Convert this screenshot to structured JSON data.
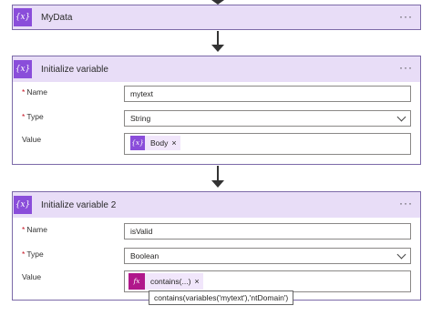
{
  "mydata_card": {
    "title": "MyData",
    "more_label": "···",
    "icon": "variable-icon"
  },
  "init_var_1": {
    "title": "Initialize variable",
    "more_label": "···",
    "name_label": "Name",
    "name_value": "mytext",
    "type_label": "Type",
    "type_value": "String",
    "value_label": "Value",
    "value_token": "Body",
    "token_remove": "×",
    "required_marker": "*"
  },
  "init_var_2": {
    "title": "Initialize variable 2",
    "more_label": "···",
    "name_label": "Name",
    "name_value": "isValid",
    "type_label": "Type",
    "type_value": "Boolean",
    "value_label": "Value",
    "value_token": "contains(...)",
    "token_icon_label": "fx",
    "token_remove": "×",
    "required_marker": "*"
  },
  "tooltip": {
    "text": "contains(variables('mytext'),'ntDomain')"
  },
  "colors": {
    "header_bg": "#e8ddf7",
    "variable_icon": "#8a4dda",
    "expression_icon": "#b0178b",
    "token_bg": "#f1e6fb"
  }
}
